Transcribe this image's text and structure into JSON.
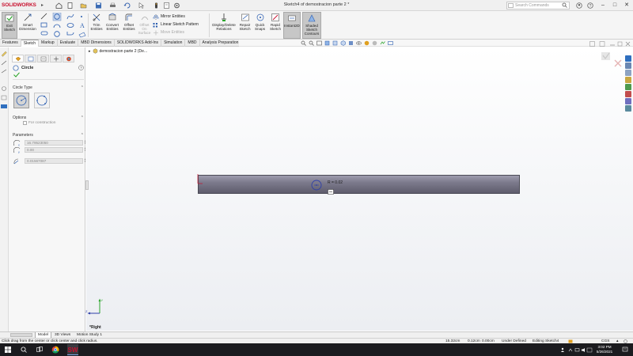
{
  "app": {
    "brand": "SOLIDWORKS",
    "document_title": "Sketch4 of demostracion parte 2 *",
    "search_placeholder": "Search Commands",
    "window_buttons": [
      "–",
      "□",
      "✕"
    ]
  },
  "ribbon": {
    "exit_sketch": "Exit Sketch",
    "smart_dimension": "Smart Dimension",
    "trim_entities": "Trim Entities",
    "convert_entities": "Convert Entities",
    "offset_entities": "Offset Entities",
    "offset_on_surface": "Offset On Surface",
    "mirror_entities": "Mirror Entities",
    "linear_sketch_pattern": "Linear Sketch Pattern",
    "move_entities": "Move Entities",
    "display_delete_relations": "Display/Delete Relations",
    "repair_sketch": "Repair Sketch",
    "quick_snaps": "Quick Snaps",
    "rapid_sketch": "Rapid Sketch",
    "instant2d": "Instant2D",
    "shaded_sketch_contours": "Shaded Sketch Contours"
  },
  "tabs": [
    {
      "label": "Features",
      "active": false
    },
    {
      "label": "Sketch",
      "active": true
    },
    {
      "label": "Markup",
      "active": false
    },
    {
      "label": "Evaluate",
      "active": false
    },
    {
      "label": "MBD Dimensions",
      "active": false
    },
    {
      "label": "SOLIDWORKS Add-Ins",
      "active": false
    },
    {
      "label": "Simulation",
      "active": false
    },
    {
      "label": "MBD",
      "active": false
    },
    {
      "label": "Analysis Preparation",
      "active": false
    }
  ],
  "panel": {
    "title": "Circle",
    "circle_type_label": "Circle Type",
    "options_label": "Options",
    "for_construction_label": "For construction",
    "parameters_label": "Parameters",
    "param_x": "16.79523050",
    "param_y": "0.00",
    "param_r": "0.01567087"
  },
  "tree": {
    "root_label": "demostracion parte 2 (De..."
  },
  "canvas": {
    "radius_label": "R = 0.02",
    "view_name": "*Right"
  },
  "bottom_tabs": [
    {
      "label": "Model",
      "active": true
    },
    {
      "label": "3D Views",
      "active": false
    },
    {
      "label": "Motion Study 1",
      "active": false
    }
  ],
  "status": {
    "hint": "Click drag from the center or click center and click radius.",
    "coord1": "15.32cm",
    "coord2": "0.12cm",
    "coord3": "0.00cm",
    "definition": "Under Defined",
    "editing": "Editing Sketch4",
    "units": "CGS"
  },
  "taskbar": {
    "time": "3:02 PM",
    "date": "5/26/2021"
  },
  "colors": {
    "brand_red": "#c8102e",
    "bar_dark": "#5e5c6c",
    "circle_blue": "#2e3fa8",
    "accent_green": "#2aa52a"
  }
}
